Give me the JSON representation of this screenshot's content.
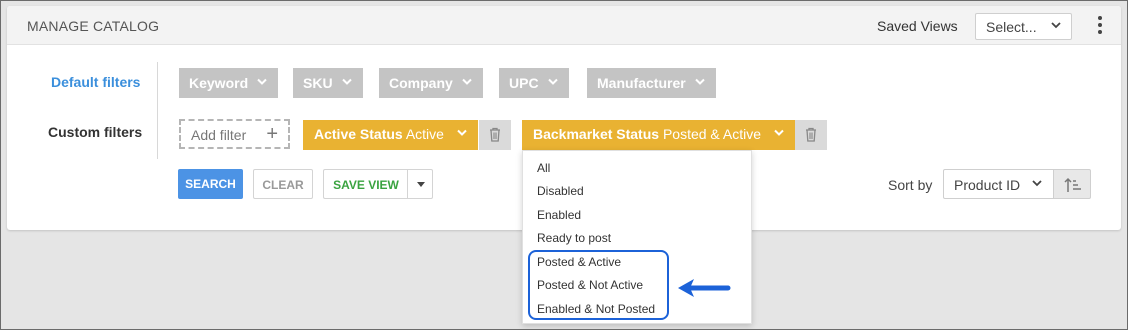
{
  "header": {
    "title": "MANAGE CATALOG",
    "saved_views_label": "Saved Views",
    "saved_views_select": "Select..."
  },
  "filters": {
    "default_label": "Default filters",
    "custom_label": "Custom filters",
    "default_chips": [
      "Keyword",
      "SKU",
      "Company",
      "UPC",
      "Manufacturer"
    ],
    "add_filter_label": "Add filter",
    "custom_chips": [
      {
        "name": "Active Status",
        "value": "Active"
      },
      {
        "name": "Backmarket Status",
        "value": "Posted & Active"
      }
    ]
  },
  "actions": {
    "search": "SEARCH",
    "clear": "CLEAR",
    "save_view": "SAVE VIEW"
  },
  "sort": {
    "label": "Sort by",
    "value": "Product ID"
  },
  "dropdown": {
    "options": [
      "All",
      "Disabled",
      "Enabled",
      "Ready to post",
      "Posted & Active",
      "Posted & Not Active",
      "Enabled & Not Posted"
    ]
  },
  "colors": {
    "accent_blue": "#4c93e5",
    "chip_yellow": "#e9b232",
    "chip_gray": "#c4c4c4",
    "save_green": "#3aa340",
    "highlight_blue": "#1c62d8"
  }
}
